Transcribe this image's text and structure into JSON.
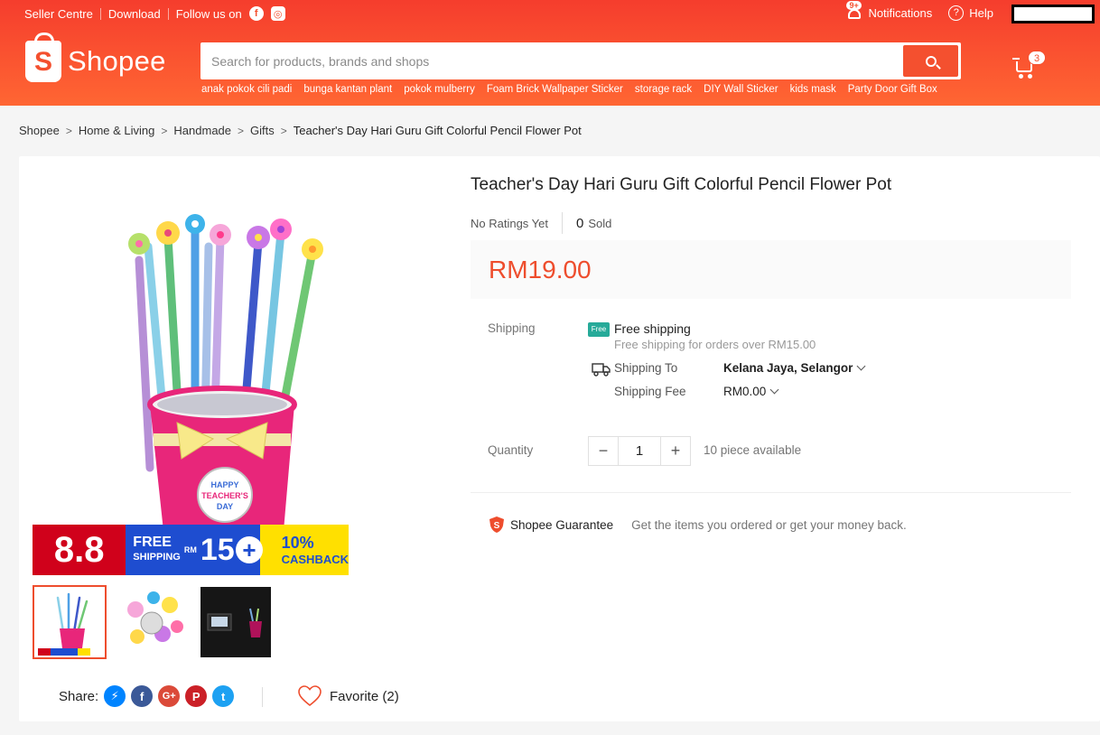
{
  "header": {
    "top_links": {
      "seller_centre": "Seller Centre",
      "download": "Download",
      "follow_us": "Follow us on"
    },
    "notifications": {
      "badge": "9+",
      "label": "Notifications"
    },
    "help": "Help",
    "logo": {
      "mark": "S",
      "word": "Shopee"
    },
    "search": {
      "placeholder": "Search for products, brands and shops",
      "value": ""
    },
    "search_hints": [
      "anak pokok cili padi",
      "bunga kantan plant",
      "pokok mulberry",
      "Foam Brick Wallpaper Sticker",
      "storage rack",
      "DIY Wall Sticker",
      "kids mask",
      "Party Door Gift Box"
    ],
    "cart_count": "3",
    "brand_color": "#f4502f"
  },
  "breadcrumb": {
    "items": [
      "Shopee",
      "Home & Living",
      "Handmade",
      "Gifts"
    ],
    "current": "Teacher's Day Hari Guru Gift Colorful Pencil Flower Pot"
  },
  "product": {
    "title": "Teacher's Day Hari Guru Gift Colorful Pencil Flower Pot",
    "ratings": "No Ratings Yet",
    "sold_count": "0",
    "sold_label": "Sold",
    "price": "RM19.00",
    "price_color": "#ee4d2d",
    "pot_label": [
      "HAPPY",
      "TEACHER'S",
      "DAY"
    ],
    "banner": {
      "big": "8.8",
      "free": "FREE",
      "shipping": "SHIPPING",
      "rm": "RM",
      "amount": "15",
      "plus": "+",
      "pct": "10%",
      "cashback": "CASHBACK"
    }
  },
  "shipping": {
    "label": "Shipping",
    "free_badge": "Free",
    "free_title": "Free shipping",
    "free_sub": "Free shipping for orders over RM15.00",
    "ship_to_label": "Shipping To",
    "ship_to_value": "Kelana Jaya, Selangor",
    "fee_label": "Shipping Fee",
    "fee_value": "RM0.00"
  },
  "quantity": {
    "label": "Quantity",
    "minus": "−",
    "value": "1",
    "plus": "+",
    "available": "10 piece available"
  },
  "guarantee": {
    "title": "Shopee Guarantee",
    "desc": "Get the items you ordered or get your money back."
  },
  "share": {
    "label": "Share:",
    "icons": [
      "messenger-icon",
      "facebook-icon",
      "google-plus-icon",
      "pinterest-icon",
      "twitter-icon"
    ]
  },
  "favorite": {
    "label": "Favorite (2)"
  }
}
